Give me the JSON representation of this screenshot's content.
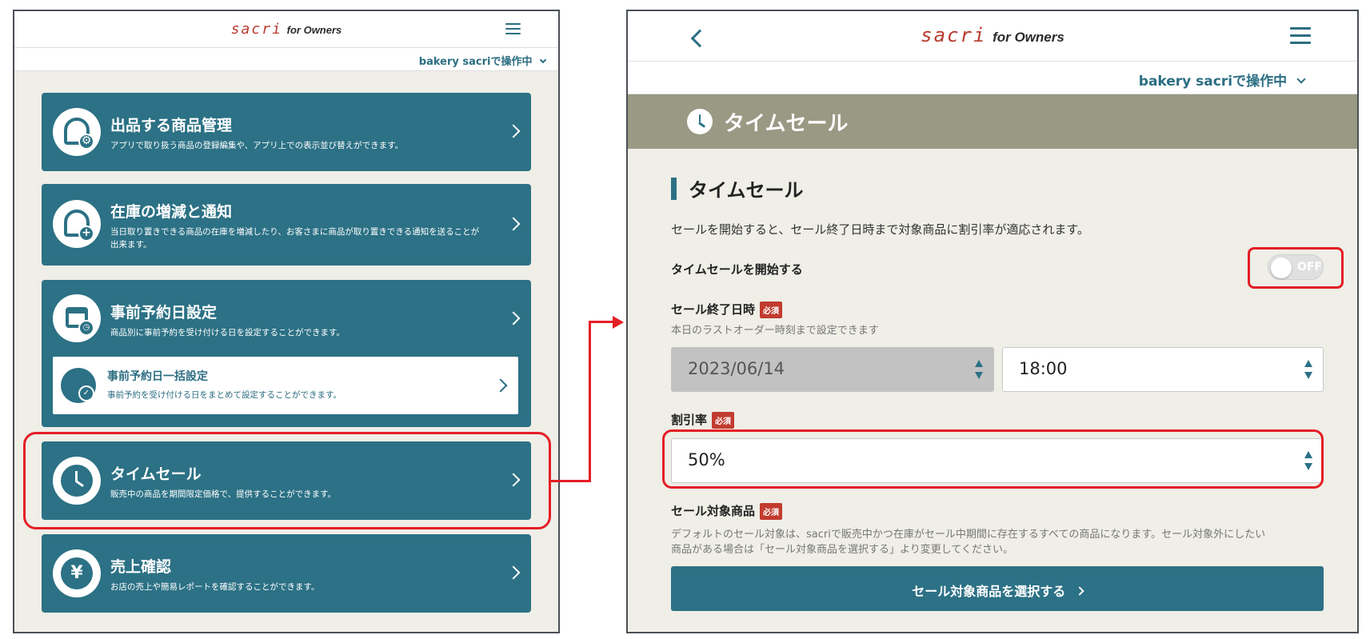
{
  "brand": {
    "logo": "sacri",
    "suffix": "for Owners"
  },
  "account": {
    "label": "bakery sacriで操作中"
  },
  "left": {
    "cards": [
      {
        "title": "出品する商品管理",
        "desc": "アプリで取り扱う商品の登録編集や、アプリ上での表示並び替えができます。"
      },
      {
        "title": "在庫の増減と通知",
        "desc": "当日取り置きできる商品の在庫を増減したり、お客さまに商品が取り置きできる通知を送ることが出来ます。"
      },
      {
        "title": "事前予約日設定",
        "desc": "商品別に事前予約を受け付ける日を設定することができます。"
      },
      {
        "title": "タイムセール",
        "desc": "販売中の商品を期間限定価格で、提供することができます。"
      },
      {
        "title": "売上確認",
        "desc": "お店の売上や簡易レポートを確認することができます。"
      }
    ],
    "subcard": {
      "title": "事前予約日一括設定",
      "desc": "事前予約を受け付ける日をまとめて設定することができます。"
    },
    "yen_glyph": "¥"
  },
  "right": {
    "banner_title": "タイムセール",
    "section_title": "タイムセール",
    "intro": "セールを開始すると、セール終了日時まで対象商品に割引率が適応されます。",
    "start_label": "タイムセールを開始する",
    "toggle_state": "OFF",
    "end_label": "セール終了日時",
    "required": "必須",
    "end_hint": "本日のラストオーダー時刻まで設定できます",
    "end_date": "2023/06/14",
    "end_time": "18:00",
    "discount_label": "割引率",
    "discount_value": "50%",
    "target_label": "セール対象商品",
    "target_hint_1": "デフォルトのセール対象は、sacriで販売中かつ在庫がセール中期間に存在するすべての商品になります。セール対象外にしたい",
    "target_hint_2": "商品がある場合は「セール対象商品を選択する」より変更してください。",
    "select_button": "セール対象商品を選択する"
  },
  "colors": {
    "primary": "#2c7185",
    "accent": "#b83a2e",
    "highlight": "#e41e26",
    "banner": "#9a9984",
    "background": "#efeee7"
  }
}
